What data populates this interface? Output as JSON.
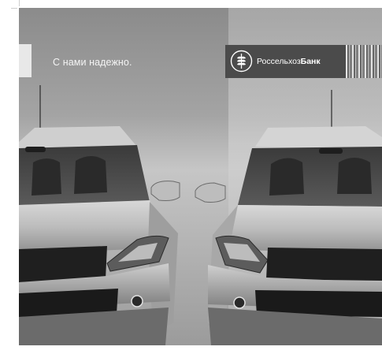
{
  "slogan": "С нами надежно.",
  "bank": {
    "name_regular": "Россельхоз",
    "name_bold": "Банк",
    "emblem_icon": "wheat-ear-emblem-icon"
  },
  "image": {
    "subject": "car-front-photo",
    "colors": {
      "background": "#a4a4a4",
      "logo_panel": "#4b4b4b",
      "slogan_text": "#f4f4f4"
    }
  }
}
